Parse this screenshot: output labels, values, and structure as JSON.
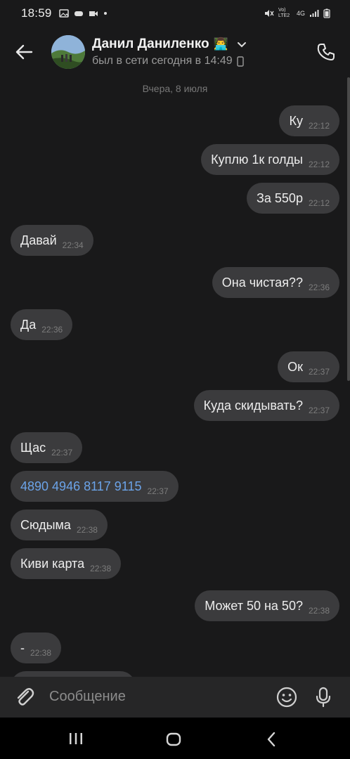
{
  "status_bar": {
    "time": "18:59",
    "network": "4G",
    "volte": "Vo) LTE2"
  },
  "header": {
    "name": "Данил Даниленко",
    "name_emoji": "👨‍💻",
    "status": "был в сети сегодня в 14:49"
  },
  "chat": {
    "date_separator": "Вчера, 8 июля",
    "messages": [
      {
        "dir": "out",
        "text": "Ку",
        "time": "22:12"
      },
      {
        "dir": "out",
        "text": "Куплю 1к голды",
        "time": "22:12"
      },
      {
        "dir": "out",
        "text": "За 550р",
        "time": "22:12"
      },
      {
        "dir": "in",
        "text": "Давай",
        "time": "22:34"
      },
      {
        "dir": "out",
        "text": "Она чистая??",
        "time": "22:36"
      },
      {
        "dir": "in",
        "text": "Да",
        "time": "22:36"
      },
      {
        "dir": "out",
        "text": "Ок",
        "time": "22:37"
      },
      {
        "dir": "out",
        "text": "Куда скидывать?",
        "time": "22:37"
      },
      {
        "dir": "in",
        "text": "Щас",
        "time": "22:37"
      },
      {
        "dir": "in",
        "text": "4890 4946 8117 9115",
        "time": "22:37",
        "link": true
      },
      {
        "dir": "in",
        "text": "Сюдыма",
        "time": "22:38"
      },
      {
        "dir": "in",
        "text": "Киви карта",
        "time": "22:38"
      },
      {
        "dir": "out",
        "text": "Может 50 на 50?",
        "time": "22:38"
      },
      {
        "dir": "in",
        "text": "-",
        "time": "22:38"
      }
    ]
  },
  "composer": {
    "placeholder": "Сообщение"
  },
  "icons": {
    "back": "arrow-left-icon",
    "call": "phone-icon",
    "attach": "paperclip-icon",
    "emoji": "smiley-icon",
    "mic": "microphone-icon"
  },
  "colors": {
    "background": "#19191a",
    "bubble": "#3b3b3d",
    "link": "#6ba3e8",
    "composer": "#262627"
  }
}
